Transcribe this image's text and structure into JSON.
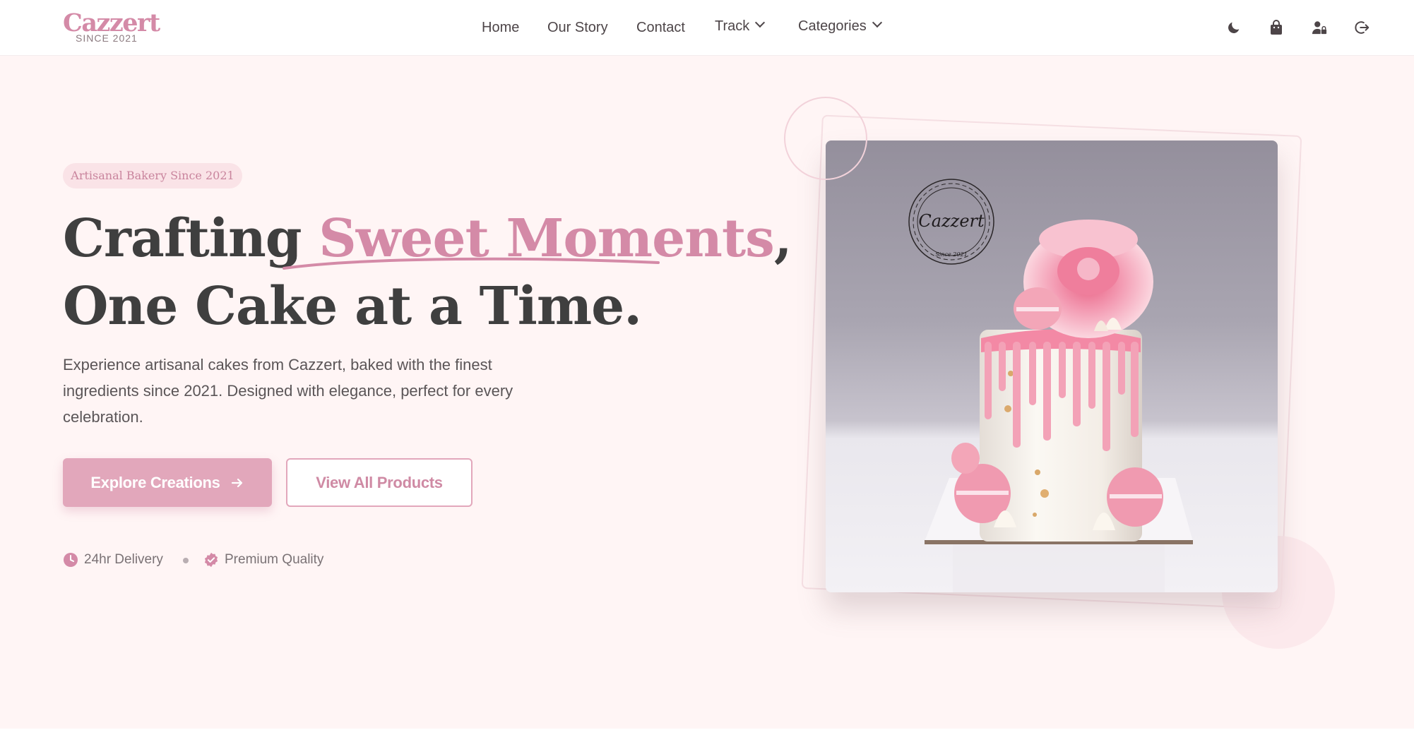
{
  "brand": {
    "name": "Cazzert",
    "since": "SINCE 2021",
    "color": "#d48aa7"
  },
  "nav": {
    "items": [
      {
        "label": "Home"
      },
      {
        "label": "Our Story"
      },
      {
        "label": "Contact"
      },
      {
        "label": "Track",
        "dropdown": true
      },
      {
        "label": "Categories",
        "dropdown": true
      }
    ]
  },
  "header_icons": [
    "moon-icon",
    "shopping-bag-icon",
    "user-lock-icon",
    "logout-icon"
  ],
  "hero": {
    "badge": "Artisanal Bakery Since 2021",
    "headline_part1": "Crafting ",
    "headline_accent": "Sweet Moments",
    "headline_part2": ",",
    "headline_line2": "One Cake at a Time.",
    "description": "Experience artisanal cakes from Cazzert, baked with the finest ingredients since 2021. Designed with elegance, perfect for every celebration.",
    "primary_button": "Explore Creations",
    "secondary_button": "View All Products",
    "features": [
      {
        "icon": "clock-icon",
        "label": "24hr Delivery"
      },
      {
        "icon": "verified-badge-icon",
        "label": "Premium Quality"
      }
    ]
  },
  "image": {
    "logo_text": "Cazzert",
    "logo_since": "Since 2021"
  },
  "colors": {
    "accent": "#d48aa7",
    "button": "#e2a7bb",
    "hero_bg": "#fff5f5",
    "text_dark": "#3f3f3f"
  }
}
